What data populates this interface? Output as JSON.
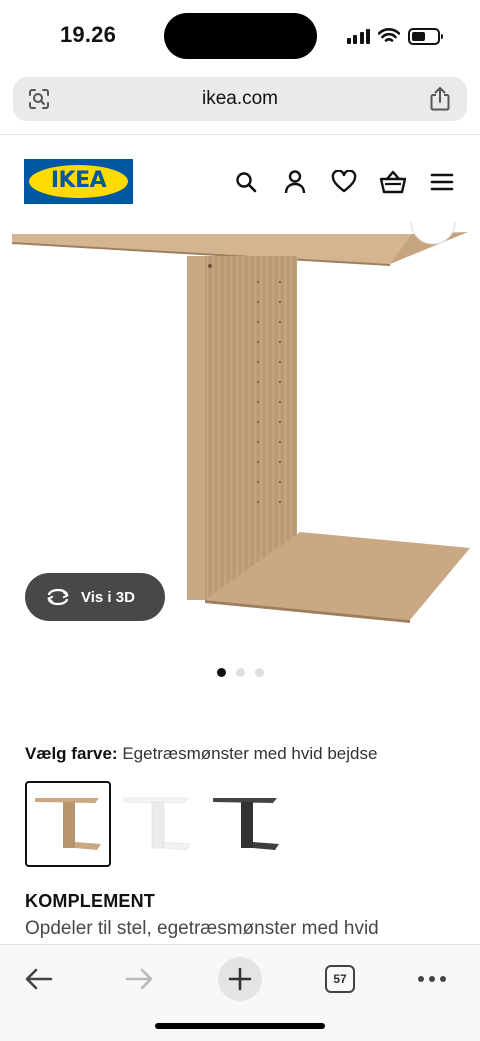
{
  "status": {
    "time": "19.26",
    "battery_level": 0.55
  },
  "browser": {
    "url": "ikea.com",
    "tab_count": "57"
  },
  "brand": {
    "logo_text": "IKEA",
    "blue": "#0058a3",
    "yellow": "#ffdb00"
  },
  "header_icons": [
    "search-icon",
    "user-icon",
    "heart-icon",
    "basket-icon",
    "menu-icon"
  ],
  "media": {
    "view_3d_label": "Vis i 3D",
    "image_count": 3,
    "active_image": 1
  },
  "color_selection": {
    "label": "Vælg farve:",
    "selected_value": "Egetræsmønster med hvid bejdse",
    "options": [
      {
        "name": "oak-effect",
        "color": "#c8a77e",
        "selected": true
      },
      {
        "name": "white",
        "color": "#f2f2f2",
        "selected": false
      },
      {
        "name": "black-brown",
        "color": "#3b3b3b",
        "selected": false
      }
    ]
  },
  "product": {
    "name": "KOMPLEMENT",
    "description": "Opdeler til stel, egetræsmønster med hvid"
  }
}
